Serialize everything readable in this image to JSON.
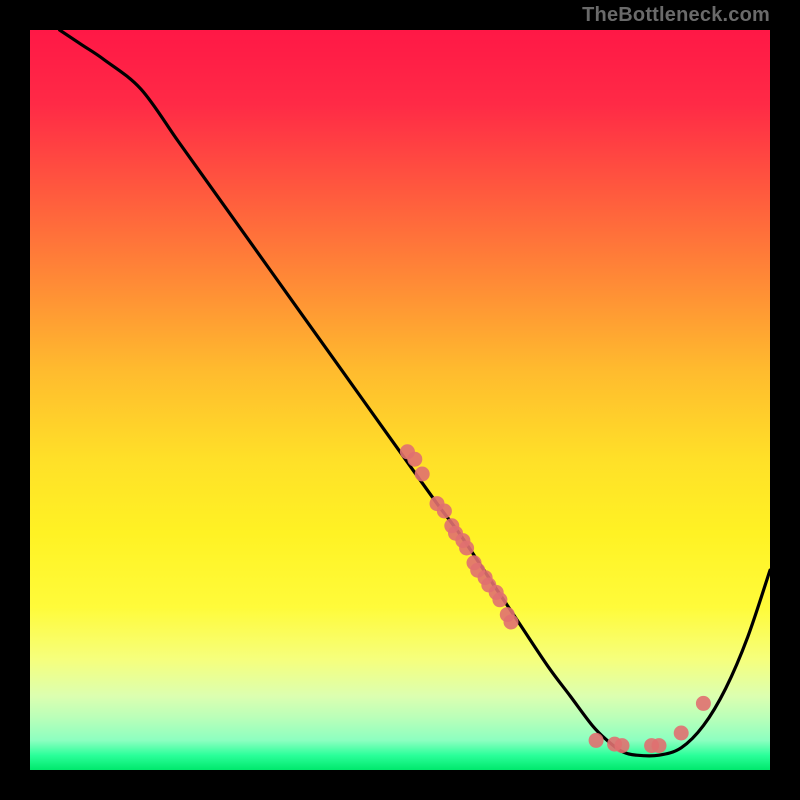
{
  "watermark": "TheBottleneck.com",
  "chart_data": {
    "type": "line",
    "title": "",
    "xlabel": "",
    "ylabel": "",
    "xlim": [
      0,
      100
    ],
    "ylim": [
      0,
      100
    ],
    "grid": false,
    "series": [
      {
        "name": "curve",
        "x": [
          4,
          7,
          10,
          15,
          20,
          25,
          30,
          35,
          40,
          45,
          50,
          55,
          58,
          62,
          66,
          70,
          73,
          76,
          78,
          80,
          82,
          85,
          88,
          91,
          94,
          97,
          100
        ],
        "y": [
          100,
          98,
          96,
          92,
          85,
          78,
          71,
          64,
          57,
          50,
          43,
          36,
          32,
          26,
          20,
          14,
          10,
          6,
          4,
          2.5,
          2,
          2,
          3,
          6,
          11,
          18,
          27
        ]
      }
    ],
    "scatter": {
      "name": "markers",
      "color": "#e07070",
      "points": [
        {
          "x": 51,
          "y": 43
        },
        {
          "x": 52,
          "y": 42
        },
        {
          "x": 53,
          "y": 40
        },
        {
          "x": 55,
          "y": 36
        },
        {
          "x": 56,
          "y": 35
        },
        {
          "x": 57,
          "y": 33
        },
        {
          "x": 57.5,
          "y": 32
        },
        {
          "x": 58.5,
          "y": 31
        },
        {
          "x": 59,
          "y": 30
        },
        {
          "x": 60,
          "y": 28
        },
        {
          "x": 60.5,
          "y": 27
        },
        {
          "x": 61.5,
          "y": 26
        },
        {
          "x": 62,
          "y": 25
        },
        {
          "x": 63,
          "y": 24
        },
        {
          "x": 63.5,
          "y": 23
        },
        {
          "x": 64.5,
          "y": 21
        },
        {
          "x": 65,
          "y": 20
        },
        {
          "x": 76.5,
          "y": 4
        },
        {
          "x": 79,
          "y": 3.5
        },
        {
          "x": 80,
          "y": 3.3
        },
        {
          "x": 84,
          "y": 3.3
        },
        {
          "x": 85,
          "y": 3.3
        },
        {
          "x": 88,
          "y": 5
        },
        {
          "x": 91,
          "y": 9
        }
      ]
    }
  }
}
